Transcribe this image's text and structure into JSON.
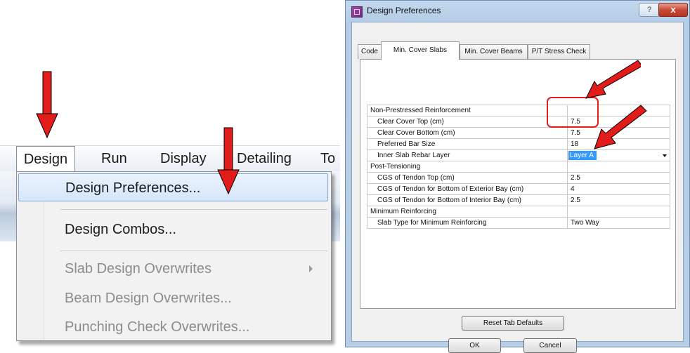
{
  "menu": {
    "bar_items": [
      "Design",
      "Run",
      "Display",
      "Detailing",
      "To"
    ],
    "dropdown_items": [
      {
        "label": "Design Preferences...",
        "enabled": true,
        "highlighted": true
      },
      {
        "label": "Design Combos...",
        "enabled": true
      },
      {
        "label": "Slab Design Overwrites",
        "enabled": false,
        "submenu": true
      },
      {
        "label": "Beam Design Overwrites...",
        "enabled": false
      },
      {
        "label": "Punching Check Overwrites...",
        "enabled": false
      }
    ]
  },
  "dialog": {
    "title": "Design Preferences",
    "help_glyph": "?",
    "close_glyph": "x",
    "tabs": [
      {
        "label": "Code",
        "active": false
      },
      {
        "label": "Min. Cover Slabs",
        "active": true
      },
      {
        "label": "Min. Cover Beams",
        "active": false
      },
      {
        "label": "P/T Stress Check",
        "active": false
      }
    ],
    "grid": [
      {
        "label": "Non-Prestressed Reinforcement",
        "value": "",
        "section": true
      },
      {
        "label": "Clear Cover Top  (cm)",
        "value": "7.5"
      },
      {
        "label": "Clear Cover Bottom  (cm)",
        "value": "7.5"
      },
      {
        "label": "Preferred Bar Size",
        "value": "18"
      },
      {
        "label": "Inner Slab Rebar Layer",
        "value": "Layer A",
        "dropdown": true
      },
      {
        "label": "Post-Tensioning",
        "value": "",
        "section": true
      },
      {
        "label": "CGS of Tendon Top  (cm)",
        "value": "2.5"
      },
      {
        "label": "CGS of Tendon for Bottom of Exterior Bay  (cm)",
        "value": "4"
      },
      {
        "label": "CGS of Tendon for Bottom of Interior Bay  (cm)",
        "value": "2.5"
      },
      {
        "label": "Minimum Reinforcing",
        "value": "",
        "section": true
      },
      {
        "label": "Slab Type for Minimum Reinforcing",
        "value": "Two Way"
      }
    ],
    "buttons": {
      "reset": "Reset Tab Defaults",
      "ok": "OK",
      "cancel": "Cancel"
    }
  },
  "annotations": {
    "arrow_color": "#e21b1b"
  }
}
